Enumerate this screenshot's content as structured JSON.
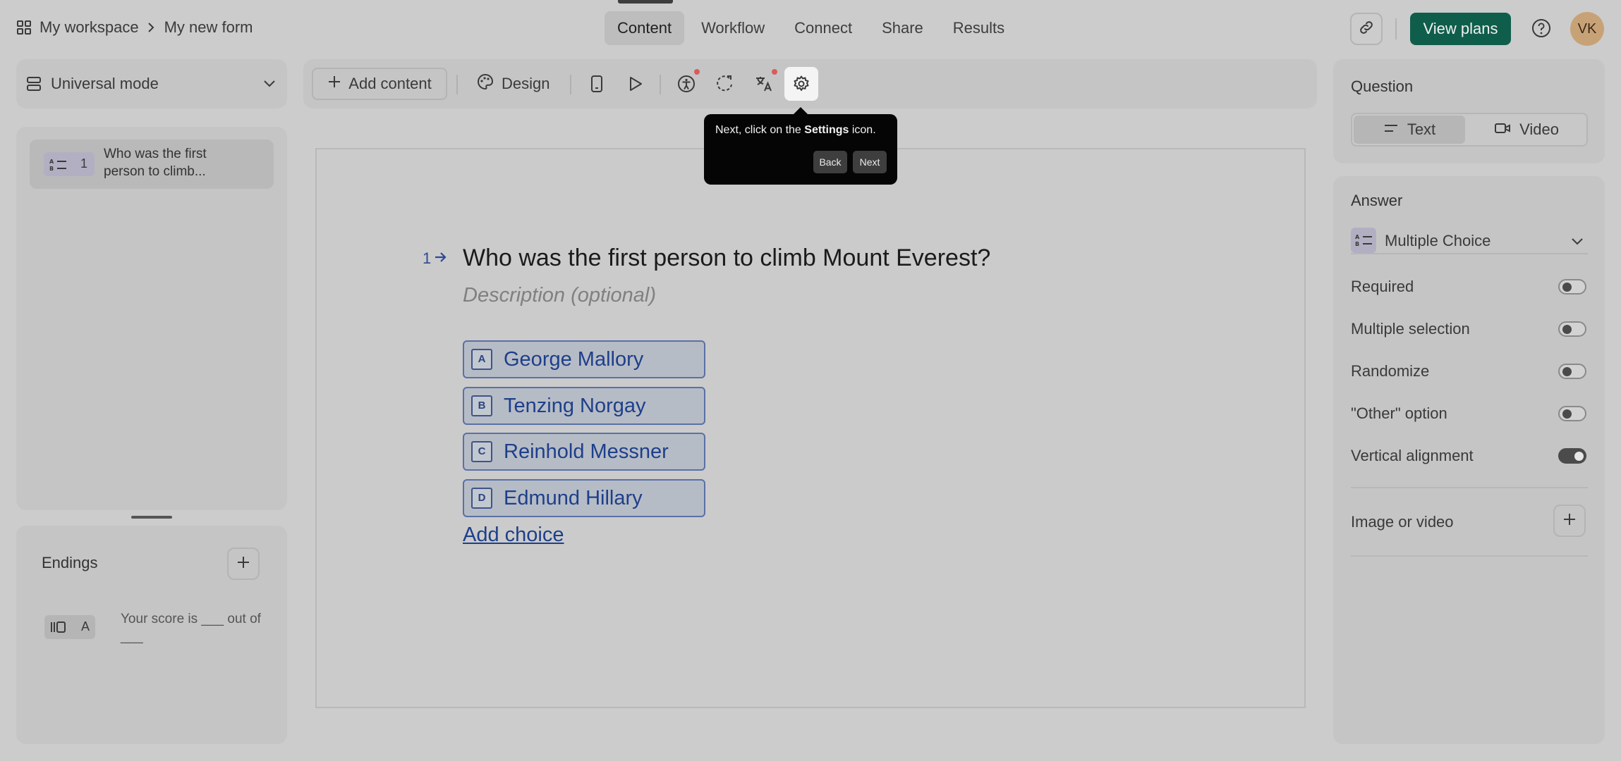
{
  "breadcrumb": {
    "workspace": "My workspace",
    "form": "My new form"
  },
  "nav_tabs": [
    "Content",
    "Workflow",
    "Connect",
    "Share",
    "Results"
  ],
  "header": {
    "view_plans": "View plans",
    "avatar_initials": "VK"
  },
  "mode": {
    "label": "Universal mode"
  },
  "toolbar": {
    "add_content": "Add content",
    "design": "Design"
  },
  "questions_list": [
    {
      "number": "1",
      "title": "Who was the first person to climb..."
    }
  ],
  "endings": {
    "title": "Endings",
    "items": [
      {
        "key": "A",
        "title": "Your score is ___ out of ___"
      }
    ]
  },
  "question": {
    "number": "1",
    "title": "Who was the first person to climb Mount Everest?",
    "description_placeholder": "Description (optional)",
    "choices": [
      {
        "key": "A",
        "label": "George Mallory"
      },
      {
        "key": "B",
        "label": "Tenzing Norgay"
      },
      {
        "key": "C",
        "label": "Reinhold Messner"
      },
      {
        "key": "D",
        "label": "Edmund Hillary"
      }
    ],
    "add_choice": "Add choice"
  },
  "tooltip": {
    "prefix": "Next, click on the ",
    "bold": "Settings",
    "suffix": " icon.",
    "back": "Back",
    "next": "Next"
  },
  "right_panel": {
    "question_label": "Question",
    "question_types": [
      "Text",
      "Video"
    ],
    "answer_label": "Answer",
    "answer_type": "Multiple Choice",
    "settings": [
      {
        "label": "Required",
        "on": false
      },
      {
        "label": "Multiple selection",
        "on": false
      },
      {
        "label": "Randomize",
        "on": false
      },
      {
        "label": "\"Other\" option",
        "on": false
      },
      {
        "label": "Vertical alignment",
        "on": true
      }
    ],
    "image_or_video": "Image or video"
  },
  "colors": {
    "accent_green": "#0f5e4c",
    "choice_blue": "#1e3f8a",
    "notification_dot": "#d85c5c"
  }
}
